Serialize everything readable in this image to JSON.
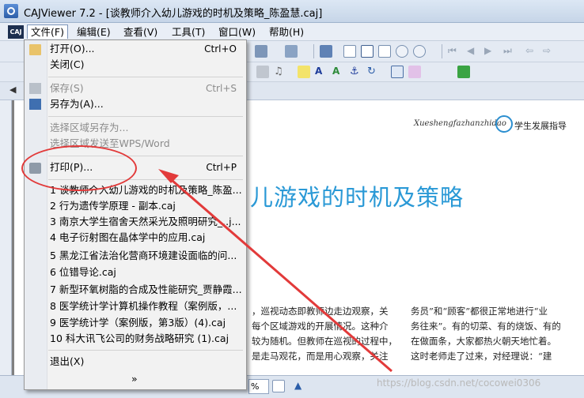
{
  "window": {
    "title": "CAJViewer 7.2 - [谈教师介入幼儿游戏的时机及策略_陈盈慧.caj]",
    "logo_text": "CAJ"
  },
  "menubar": {
    "items": [
      "文件(F)",
      "编辑(E)",
      "查看(V)",
      "工具(T)",
      "窗口(W)",
      "帮助(H)"
    ]
  },
  "file_menu": {
    "open": "打开(O)...",
    "open_shortcut": "Ctrl+O",
    "close": "关闭(C)",
    "save": "保存(S)",
    "save_shortcut": "Ctrl+S",
    "save_as": "另存为(A)...",
    "save_region_as": "选择区域另存为...",
    "send_region_wps": "选择区域发送至WPS/Word",
    "print": "打印(P)...",
    "print_shortcut": "Ctrl+P",
    "recent": [
      "1 谈教师介入幼儿游戏的时机及策略_陈盈...",
      "2 行为遗传学原理 - 副本.caj",
      "3 南京大学生宿舍天然采光及照明研究_..j...",
      "4 电子衍射图在晶体学中的应用.caj",
      "5 黑龙江省法治化营商环境建设面临的问...",
      "6 位错导论.caj",
      "7 新型环氧树脂的合成及性能研究_贾静霞...",
      "8 医学统计学计算机操作教程（案例版，...",
      "9 医学统计学（案例版，第3版）(4).caj",
      "10 科大讯飞公司的财务战略研究 (1).caj"
    ],
    "exit": "退出(X)",
    "more": "»"
  },
  "document": {
    "header_latin": "Xueshengfazhanzhidao",
    "header_cn": "学生发展指导",
    "title_fragment": "儿游戏的时机及策略",
    "col1_lines": [
      "，巡视动态即教师边走边观察，关",
      "每个区域游戏的开展情况。这种介",
      "较为随机。但教师在巡视的过程中，",
      "是走马观花，而是用心观察，关注"
    ],
    "col2_lines": [
      "务员”和“顾客”都很正常地进行“业",
      "务往来”。有的切菜、有的烧饭、有的",
      "在做面条，大家都热火朝天地忙着。",
      "这时老师走了过来，对经理说：“建"
    ]
  },
  "status": {
    "zoom": "%",
    "watermark": "https://blog.csdn.net/cocowei0306"
  },
  "colors": {
    "annotation": "#e23a3a",
    "title_blue": "#2a99d6"
  }
}
